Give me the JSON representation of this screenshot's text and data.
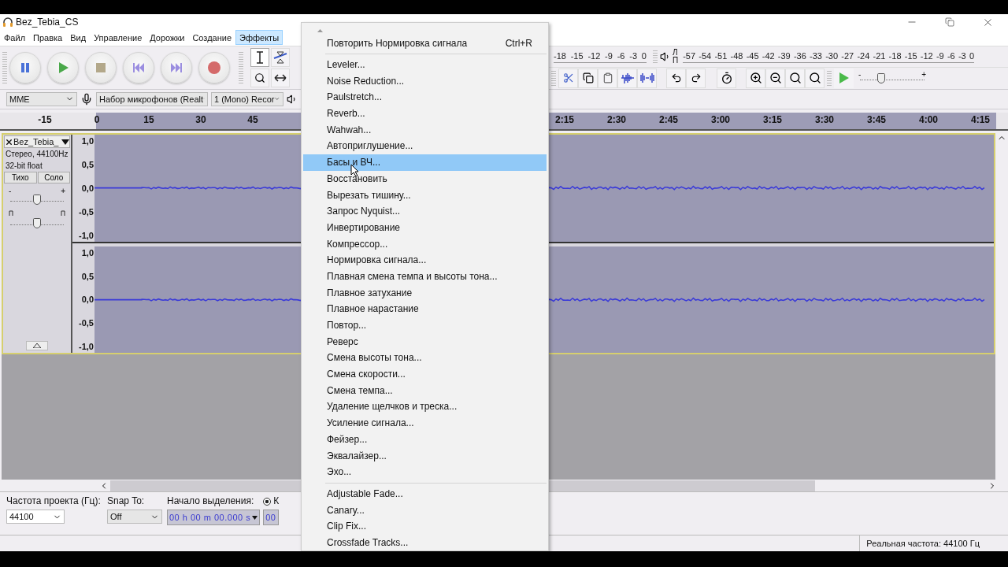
{
  "window": {
    "title": "Bez_Tebia_CS"
  },
  "menu_bar": [
    {
      "label": "Файл",
      "selected": false
    },
    {
      "label": "Правка",
      "selected": false
    },
    {
      "label": "Вид",
      "selected": false
    },
    {
      "label": "Управление",
      "selected": false
    },
    {
      "label": "Дорожки",
      "selected": false
    },
    {
      "label": "Создание",
      "selected": false
    },
    {
      "label": "Эффекты",
      "selected": true
    }
  ],
  "recording_meter": {
    "ticks": [
      "-18",
      "-15",
      "-12",
      "-9",
      "-6",
      "-3",
      "0"
    ]
  },
  "playback_meter": {
    "channels": [
      "Л",
      "П"
    ],
    "ticks": [
      "-57",
      "-54",
      "-51",
      "-48",
      "-45",
      "-42",
      "-39",
      "-36",
      "-33",
      "-30",
      "-27",
      "-24",
      "-21",
      "-18",
      "-15",
      "-12",
      "-9",
      "-6",
      "-3",
      "0"
    ]
  },
  "play_at_speed": {
    "min": "-",
    "max": "+",
    "level": 0.33
  },
  "devices": {
    "host": "MME",
    "input": "Набор микрофонов (Realt",
    "channels": "1 (Mono) Recor"
  },
  "ruler": {
    "left_ticks": [
      "-15",
      "0",
      "15",
      "30",
      "45"
    ],
    "right_ticks": [
      "2:15",
      "2:30",
      "2:45",
      "3:00",
      "3:15",
      "3:30",
      "3:45",
      "4:00",
      "4:15"
    ]
  },
  "track": {
    "name": "Bez_Tebia_",
    "info": [
      "Стерео, 44100Hz",
      "32-bit float"
    ],
    "mute": "Тихо",
    "solo": "Соло",
    "gain": {
      "min": "-",
      "max": "+",
      "level": 0.5
    },
    "pan": {
      "level": 0.5
    },
    "channels": [
      {
        "scale": [
          "1,0",
          "0,5",
          "0,0",
          "-0,5",
          "-1,0"
        ]
      },
      {
        "scale": [
          "1,0",
          "0,5",
          "0,0",
          "-0,5",
          "-1,0"
        ]
      }
    ]
  },
  "selection_bar": {
    "rate_label": "Частота проекта (Гц):",
    "rate": "44100",
    "snap_label": "Snap To:",
    "snap": "Off",
    "start_label": "Начало выделения:",
    "start": "00 h 00 m 00.000 s",
    "end_option": {
      "label": "К",
      "selected": true
    },
    "end": "00"
  },
  "status_bar": {
    "rate": "Реальная частота: 44100 Гц"
  },
  "effects_menu": {
    "repeat": {
      "label": "Повторить Нормировка сигнала",
      "shortcut": "Ctrl+R"
    },
    "sections": [
      [
        {
          "label": "Leveler...",
          "selected": false
        },
        {
          "label": "Noise Reduction...",
          "selected": false
        },
        {
          "label": "Paulstretch...",
          "selected": false
        },
        {
          "label": "Reverb...",
          "selected": false
        },
        {
          "label": "Wahwah...",
          "selected": false
        },
        {
          "label": "Автоприглушение...",
          "selected": false
        },
        {
          "label": "Басы и ВЧ...",
          "selected": true
        },
        {
          "label": "Восстановить",
          "selected": false
        },
        {
          "label": "Вырезать тишину...",
          "selected": false
        },
        {
          "label": "Запрос Nyquist...",
          "selected": false
        },
        {
          "label": "Инвертирование",
          "selected": false
        },
        {
          "label": "Компрессор...",
          "selected": false
        },
        {
          "label": "Нормировка сигнала...",
          "selected": false
        },
        {
          "label": "Плавная смена темпа и высоты тона...",
          "selected": false
        },
        {
          "label": "Плавное затухание",
          "selected": false
        },
        {
          "label": "Плавное нарастание",
          "selected": false
        },
        {
          "label": "Повтор...",
          "selected": false
        },
        {
          "label": "Реверс",
          "selected": false
        },
        {
          "label": "Смена высоты тона...",
          "selected": false
        },
        {
          "label": "Смена скорости...",
          "selected": false
        },
        {
          "label": "Смена темпа...",
          "selected": false
        },
        {
          "label": "Удаление щелчков и треска...",
          "selected": false
        },
        {
          "label": "Усиление сигнала...",
          "selected": false
        },
        {
          "label": "Фейзер...",
          "selected": false
        },
        {
          "label": "Эквалайзер...",
          "selected": false
        },
        {
          "label": "Эхо...",
          "selected": false
        }
      ],
      [
        {
          "label": "Adjustable Fade...",
          "selected": false
        },
        {
          "label": "Canary...",
          "selected": false
        },
        {
          "label": "Clip Fix...",
          "selected": false
        },
        {
          "label": "Crossfade Tracks...",
          "selected": false
        }
      ]
    ]
  }
}
